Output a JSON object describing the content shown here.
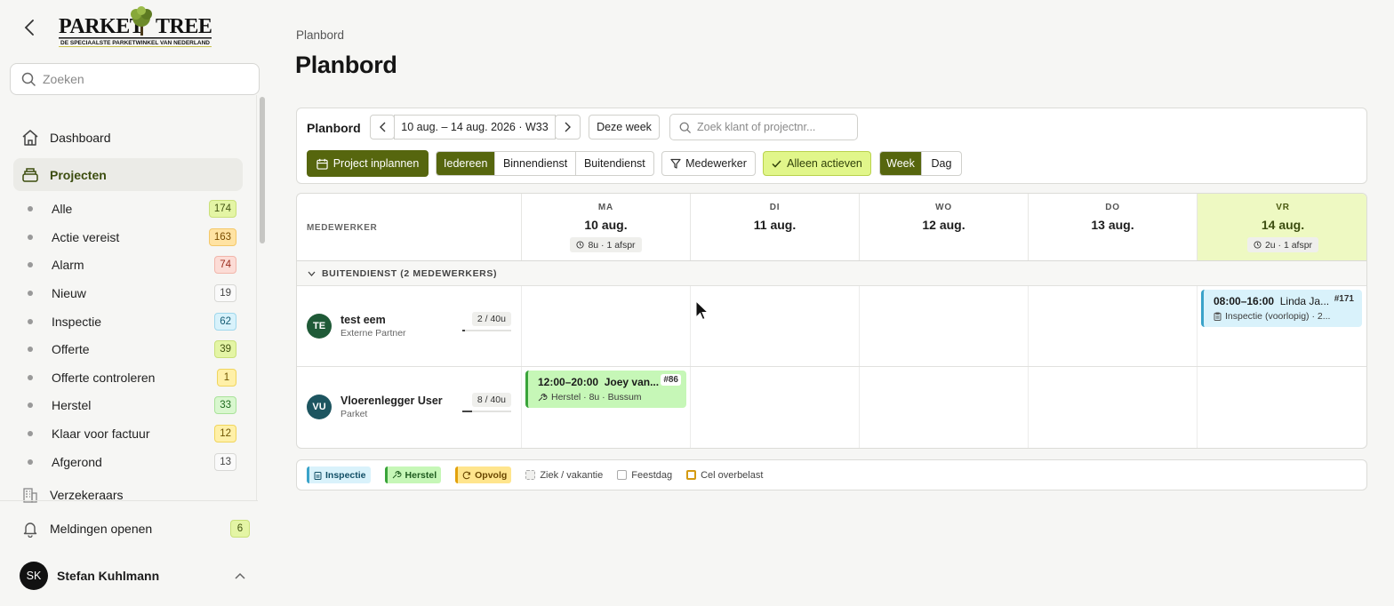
{
  "sidebar": {
    "logo": {
      "brand": "PARKET TREE",
      "tagline": "DE SPECIAALSTE PARKETWINKEL VAN NEDERLAND"
    },
    "search_placeholder": "Zoeken",
    "nav": {
      "dashboard": "Dashboard",
      "projecten": "Projecten",
      "verzekeraars": "Verzekeraars",
      "meldingen": "Meldingen openen",
      "meldingen_count": "6"
    },
    "sub_items": [
      {
        "label": "Alle",
        "count": "174"
      },
      {
        "label": "Actie vereist",
        "count": "163"
      },
      {
        "label": "Alarm",
        "count": "74"
      },
      {
        "label": "Nieuw",
        "count": "19"
      },
      {
        "label": "Inspectie",
        "count": "62"
      },
      {
        "label": "Offerte",
        "count": "39"
      },
      {
        "label": "Offerte controleren",
        "count": "1"
      },
      {
        "label": "Herstel",
        "count": "33"
      },
      {
        "label": "Klaar voor factuur",
        "count": "12"
      },
      {
        "label": "Afgerond",
        "count": "13"
      }
    ],
    "user": {
      "initials": "SK",
      "name": "Stefan Kuhlmann"
    }
  },
  "page": {
    "breadcrumb": "Planbord",
    "title": "Planbord"
  },
  "toolbar": {
    "title": "Planbord",
    "range": "10 aug. – 14 aug. 2026 · W33",
    "this_week": "Deze week",
    "search_placeholder": "Zoek klant of projectnr...",
    "plan_project": "Project inplannen",
    "segments": [
      "Iedereen",
      "Binnendienst",
      "Buitendienst"
    ],
    "medewerker": "Medewerker",
    "only_active": "Alleen actieven",
    "views": [
      "Week",
      "Dag"
    ]
  },
  "grid": {
    "employee_header": "MEDEWERKER",
    "days": [
      {
        "name": "MA",
        "date": "10 aug.",
        "summary": "8u · 1 afspr"
      },
      {
        "name": "DI",
        "date": "11 aug.",
        "summary": ""
      },
      {
        "name": "WO",
        "date": "12 aug.",
        "summary": ""
      },
      {
        "name": "DO",
        "date": "13 aug.",
        "summary": ""
      },
      {
        "name": "VR",
        "date": "14 aug.",
        "summary": "2u · 1 afspr"
      }
    ],
    "group": "BUITENDIENST (2 MEDEWERKERS)",
    "employees": [
      {
        "initials": "TE",
        "name": "test eem",
        "role": "Externe Partner",
        "capacity": "2 / 40u",
        "load": 0.05
      },
      {
        "initials": "VU",
        "name": "Vloerenlegger User",
        "role": "Parket",
        "capacity": "8 / 40u",
        "load": 0.2
      }
    ],
    "events": [
      {
        "time": "08:00–16:00",
        "client": "Linda Ja...",
        "number": "#171",
        "detail": "Inspectie (voorlopig) · 2..."
      },
      {
        "time": "12:00–20:00",
        "client": "Joey van...",
        "number": "#86",
        "detail": "Herstel · 8u · Bussum"
      }
    ]
  },
  "legend": {
    "inspectie": "Inspectie",
    "herstel": "Herstel",
    "opvolg": "Opvolg",
    "ziek": "Ziek / vakantie",
    "feestdag": "Feestdag",
    "overbelast": "Cel overbelast"
  },
  "colors": {
    "olive": "#56660e",
    "lime": "#e1f68a",
    "inspectie": "#3aa3c9",
    "herstel": "#3aa43a",
    "opvolg": "#e2a20c"
  }
}
